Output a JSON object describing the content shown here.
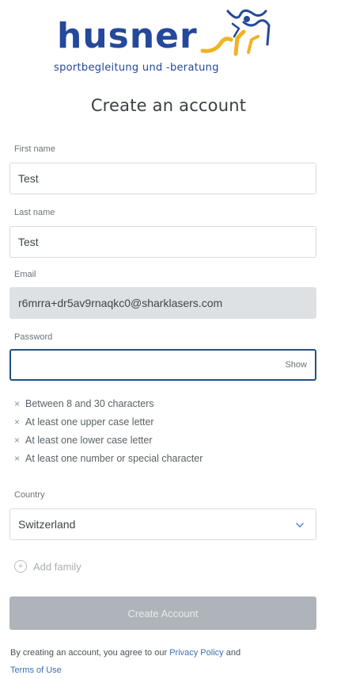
{
  "brand": {
    "wordmark": "husner",
    "tagline": "sportbegleitung und -beratung",
    "color": "#24489b",
    "accent_color": "#f0b323"
  },
  "page": {
    "title": "Create an account"
  },
  "form": {
    "first_name": {
      "label": "First name",
      "value": "Test"
    },
    "last_name": {
      "label": "Last name",
      "value": "Test"
    },
    "email": {
      "label": "Email",
      "value": "r6mrra+dr5av9rnaqkc0@sharklasers.com"
    },
    "password": {
      "label": "Password",
      "value": "",
      "show_label": "Show"
    },
    "password_rules": [
      "Between 8 and 30 characters",
      "At least one upper case letter",
      "At least one lower case letter",
      "At least one number or special character"
    ],
    "country": {
      "label": "Country",
      "value": "Switzerland",
      "icon": "chevron-down-icon"
    },
    "add_family_label": "Add family",
    "submit_label": "Create Account"
  },
  "legal": {
    "prefix": "By creating an account, you agree to our ",
    "privacy_link": "Privacy Policy",
    "and": " and",
    "terms_link": "Terms of Use"
  },
  "colors": {
    "focus_border": "#254f84",
    "disabled_button": "#aeb4b9",
    "link": "#3a6fb5",
    "readonly_field": "#dde1e3"
  }
}
